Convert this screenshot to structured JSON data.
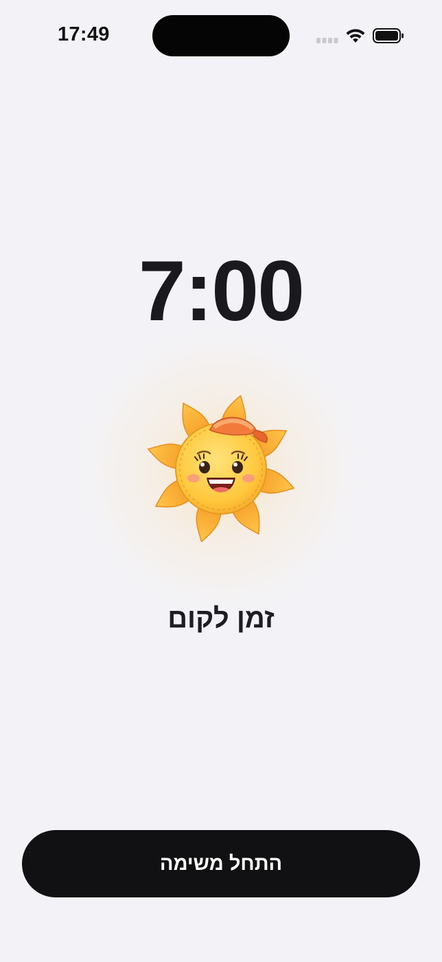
{
  "status_bar": {
    "time": "17:49",
    "icons": [
      "cellular-signal-icon",
      "wifi-icon",
      "battery-icon"
    ]
  },
  "alarm": {
    "time": "7:00",
    "illustration": "smiling-sun-with-cap-icon",
    "caption": "זמן לקום"
  },
  "actions": {
    "start_task_label": "התחל משימה"
  },
  "colors": {
    "background": "#f3f3f7",
    "text": "#1a1a1e",
    "button_bg": "#111113",
    "button_text": "#ffffff",
    "sun_body": "#ffc93f",
    "sun_rays": "#ffb43a",
    "cap": "#f27a3a"
  }
}
